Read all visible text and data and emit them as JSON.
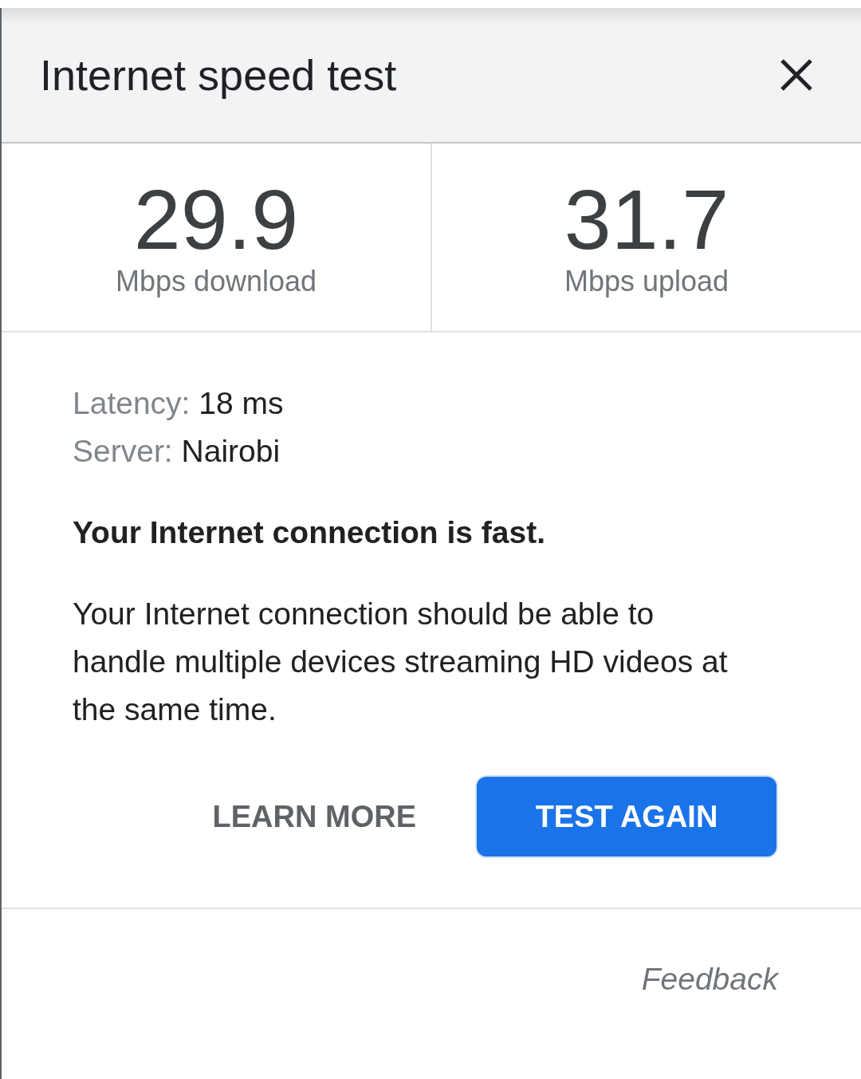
{
  "dialog": {
    "title": "Internet speed test"
  },
  "results": [
    {
      "value": "29.9",
      "label": "Mbps download"
    },
    {
      "value": "31.7",
      "label": "Mbps upload"
    }
  ],
  "details": [
    {
      "label": "Latency:",
      "value": "18 ms"
    },
    {
      "label": "Server:",
      "value": "Nairobi"
    }
  ],
  "verdict": "Your Internet connection is fast.",
  "description": "Your Internet connection should be able to handle multiple devices streaming HD videos at the same time.",
  "buttons": [
    {
      "label": "LEARN MORE",
      "kind": "text"
    },
    {
      "label": "TEST AGAIN",
      "kind": "filled"
    }
  ],
  "feedback": "Feedback"
}
